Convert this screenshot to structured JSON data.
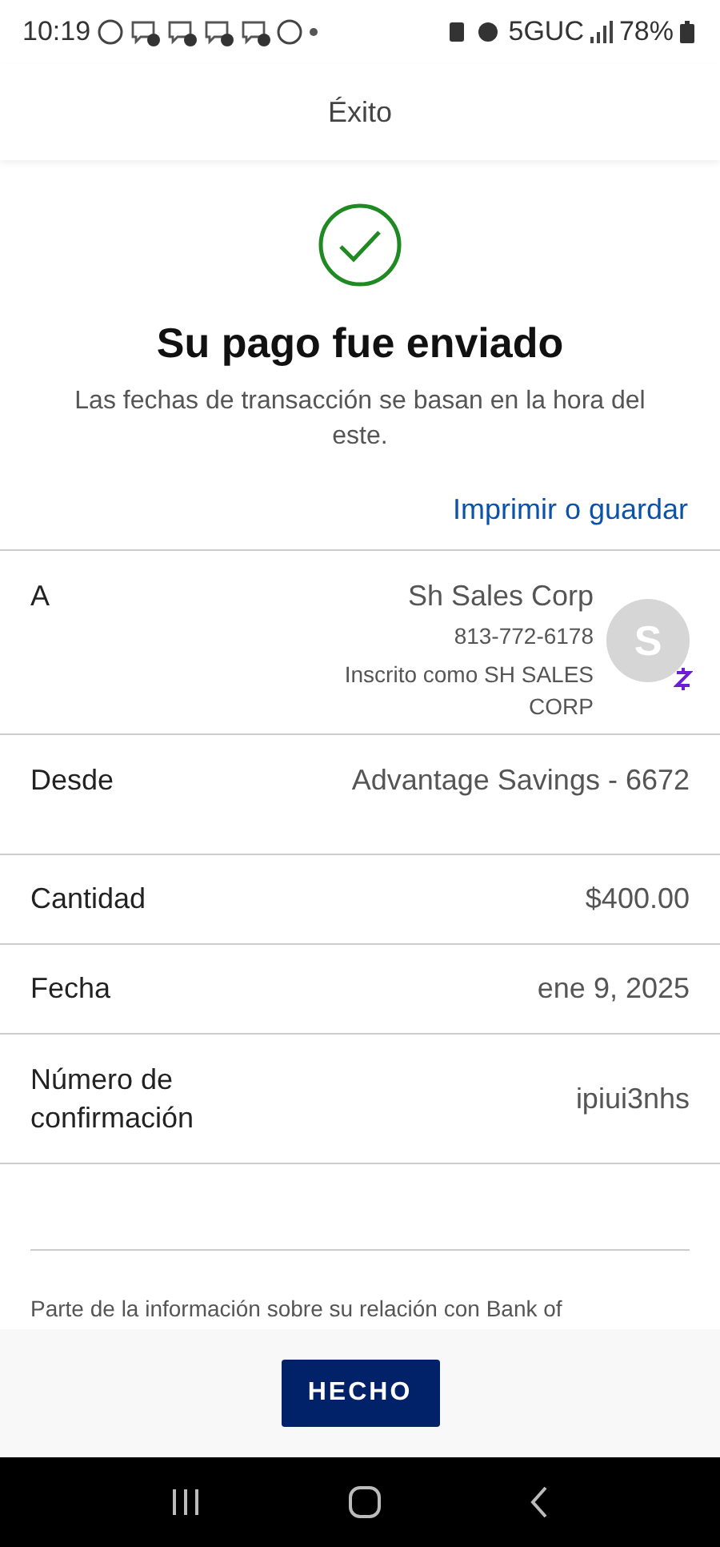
{
  "status_bar": {
    "time": "10:19",
    "network": "5GUC",
    "battery": "78%"
  },
  "header": {
    "title": "Éxito"
  },
  "confirmation": {
    "title": "Su pago fue enviado",
    "subtitle": "Las fechas de transacción se basan en la hora del este.",
    "link": "Imprimir o guardar"
  },
  "recipient": {
    "label": "A",
    "name": "Sh Sales Corp",
    "phone": "813-772-6178",
    "enrolled": "Inscrito como SH SALES CORP",
    "avatar": "S"
  },
  "details": [
    {
      "label": "Desde",
      "value": "Advantage Savings - 6672"
    },
    {
      "label": "Cantidad",
      "value": "$400.00"
    },
    {
      "label": "Fecha",
      "value": "ene 9, 2025"
    },
    {
      "label": "Número de confirmación",
      "value": "ipiui3nhs"
    }
  ],
  "disclaimer": "Parte de la información sobre su relación con Bank of",
  "done_button": "HECHO"
}
